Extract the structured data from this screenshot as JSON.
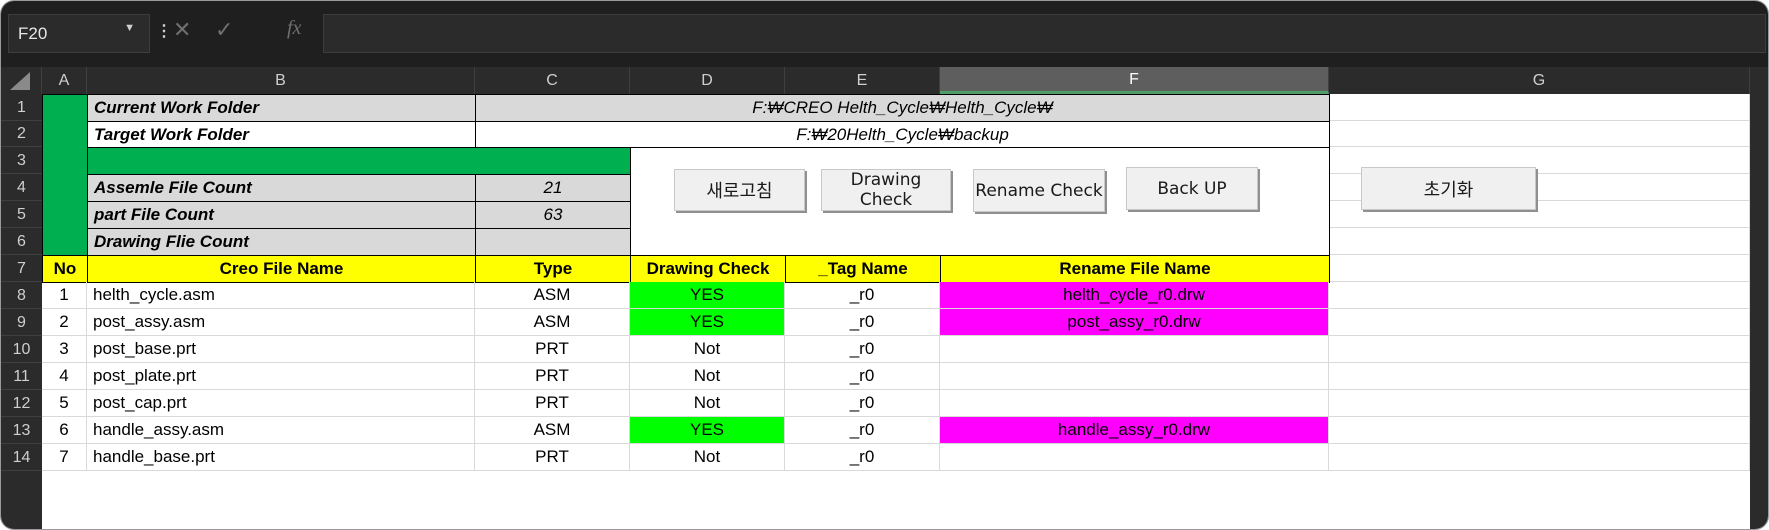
{
  "name_box": "F20",
  "formula_bar": {
    "cancel_icon": "✕",
    "enter_icon": "✓",
    "fx_icon": "fx"
  },
  "columns": [
    "A",
    "B",
    "C",
    "D",
    "E",
    "F",
    "G"
  ],
  "rows": [
    "1",
    "2",
    "3",
    "4",
    "5",
    "6",
    "7",
    "8",
    "9",
    "10",
    "11",
    "12",
    "13",
    "14"
  ],
  "selected_column": "F",
  "info": {
    "current_label": "Current Work Folder",
    "current_value": "F:₩CREO Helth_Cycle₩Helth_Cycle₩",
    "target_label": "Target Work Folder",
    "target_value": "F:₩20Helth_Cycle₩backup",
    "assemble_label": "Assemle File Count",
    "assemble_value": "21",
    "part_label": "part File Count",
    "part_value": "63",
    "drawing_label": "Drawing Flie Count",
    "drawing_value": ""
  },
  "buttons": {
    "refresh": "새로고침",
    "drawing_check": "Drawing Check",
    "rename_check": "Rename Check",
    "backup": "Back UP",
    "reset": "초기화"
  },
  "table": {
    "headers": [
      "No",
      "Creo File Name",
      "Type",
      "Drawing Check",
      "_Tag Name",
      "Rename File Name"
    ],
    "rows": [
      {
        "no": "1",
        "name": "helth_cycle.asm",
        "type": "ASM",
        "check": "YES",
        "tag": "_r0",
        "rename": "helth_cycle_r0.drw"
      },
      {
        "no": "2",
        "name": "post_assy.asm",
        "type": "ASM",
        "check": "YES",
        "tag": "_r0",
        "rename": "post_assy_r0.drw"
      },
      {
        "no": "3",
        "name": "post_base.prt",
        "type": "PRT",
        "check": "Not",
        "tag": "_r0",
        "rename": ""
      },
      {
        "no": "4",
        "name": "post_plate.prt",
        "type": "PRT",
        "check": "Not",
        "tag": "_r0",
        "rename": ""
      },
      {
        "no": "5",
        "name": "post_cap.prt",
        "type": "PRT",
        "check": "Not",
        "tag": "_r0",
        "rename": ""
      },
      {
        "no": "6",
        "name": "handle_assy.asm",
        "type": "ASM",
        "check": "YES",
        "tag": "_r0",
        "rename": "handle_assy_r0.drw"
      },
      {
        "no": "7",
        "name": "handle_base.prt",
        "type": "PRT",
        "check": "Not",
        "tag": "_r0",
        "rename": ""
      }
    ]
  },
  "colors": {
    "green_bar": "#00b050",
    "header_fill": "#ffff00",
    "yes_fill": "#00ff00",
    "rename_fill": "#ff00ff",
    "label_fill": "#d9d9d9"
  }
}
